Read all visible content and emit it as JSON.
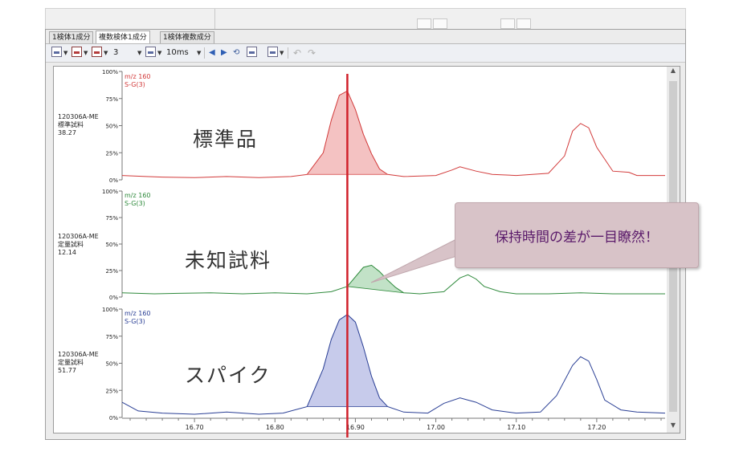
{
  "tabs": [
    {
      "label": "1検体1成分",
      "active": false
    },
    {
      "label": "複数検体1成分",
      "active": true
    },
    {
      "label": "1検体複数成分",
      "active": false
    }
  ],
  "toolbar": {
    "overlay_count": "3",
    "time_step": "10ms"
  },
  "colors": {
    "standard": "#d23a3a",
    "unknown": "#2f8a3c",
    "spike": "#2a3f95",
    "marker": "#d0202a",
    "callout_bg": "#d8c3c8",
    "callout_text": "#5a1a6a"
  },
  "chromatograms": [
    {
      "sample_id": "120306A-ME",
      "sample_type": "標準試料",
      "value": "38.27",
      "mz": "m/z 160",
      "smoothing": "S-G(3)",
      "label": "標準品",
      "y_ticks": [
        "100%",
        "75%",
        "50%",
        "25%",
        "0%"
      ]
    },
    {
      "sample_id": "120306A-ME",
      "sample_type": "定量試料",
      "value": "12.14",
      "mz": "m/z 160",
      "smoothing": "S-G(3)",
      "label": "未知試料",
      "y_ticks": [
        "100%",
        "75%",
        "50%",
        "25%",
        "0%"
      ]
    },
    {
      "sample_id": "120306A-ME",
      "sample_type": "定量試料",
      "value": "51.77",
      "mz": "m/z 160",
      "smoothing": "S-G(3)",
      "label": "スパイク",
      "y_ticks": [
        "100%",
        "75%",
        "50%",
        "25%",
        "0%"
      ]
    }
  ],
  "x_axis": {
    "ticks": [
      "16.70",
      "16.80",
      "16.90",
      "17.00",
      "17.10",
      "17.20"
    ]
  },
  "callout": {
    "text": "保持時間の差が一目瞭然！"
  },
  "chart_data": {
    "type": "line",
    "x_range": [
      16.61,
      17.285
    ],
    "y_range": [
      0,
      100
    ],
    "retention_marker": 16.89,
    "series": [
      {
        "name": "m/z 160",
        "points": [
          [
            16.61,
            4
          ],
          [
            16.64,
            3
          ],
          [
            16.66,
            2.5
          ],
          [
            16.7,
            2
          ],
          [
            16.74,
            3
          ],
          [
            16.78,
            2
          ],
          [
            16.82,
            3
          ],
          [
            16.84,
            5
          ],
          [
            16.86,
            25
          ],
          [
            16.87,
            55
          ],
          [
            16.88,
            78
          ],
          [
            16.89,
            82
          ],
          [
            16.9,
            65
          ],
          [
            16.91,
            42
          ],
          [
            16.92,
            24
          ],
          [
            16.93,
            10
          ],
          [
            16.94,
            5
          ],
          [
            16.96,
            3
          ],
          [
            17.0,
            4
          ],
          [
            17.02,
            9
          ],
          [
            17.03,
            12
          ],
          [
            17.05,
            8
          ],
          [
            17.07,
            5
          ],
          [
            17.1,
            4
          ],
          [
            17.14,
            6
          ],
          [
            17.16,
            22
          ],
          [
            17.17,
            45
          ],
          [
            17.18,
            52
          ],
          [
            17.19,
            48
          ],
          [
            17.2,
            30
          ],
          [
            17.22,
            8
          ],
          [
            17.24,
            7
          ],
          [
            17.25,
            4
          ],
          [
            17.285,
            4
          ]
        ]
      },
      {
        "name": "m/z 160",
        "points": [
          [
            16.61,
            4
          ],
          [
            16.65,
            3
          ],
          [
            16.68,
            3.5
          ],
          [
            16.72,
            4
          ],
          [
            16.76,
            3
          ],
          [
            16.8,
            4
          ],
          [
            16.84,
            3
          ],
          [
            16.87,
            5
          ],
          [
            16.89,
            10
          ],
          [
            16.91,
            28
          ],
          [
            16.92,
            30
          ],
          [
            16.93,
            24
          ],
          [
            16.94,
            16
          ],
          [
            16.95,
            9
          ],
          [
            16.96,
            4
          ],
          [
            16.98,
            3
          ],
          [
            17.01,
            5
          ],
          [
            17.03,
            18
          ],
          [
            17.04,
            21
          ],
          [
            17.05,
            17
          ],
          [
            17.06,
            10
          ],
          [
            17.08,
            5
          ],
          [
            17.1,
            3
          ],
          [
            17.14,
            3
          ],
          [
            17.18,
            4
          ],
          [
            17.22,
            3
          ],
          [
            17.285,
            3
          ]
        ]
      },
      {
        "name": "m/z 160",
        "points": [
          [
            16.61,
            14
          ],
          [
            16.63,
            6
          ],
          [
            16.66,
            4
          ],
          [
            16.7,
            3
          ],
          [
            16.74,
            5
          ],
          [
            16.78,
            3
          ],
          [
            16.81,
            4
          ],
          [
            16.84,
            10
          ],
          [
            16.86,
            45
          ],
          [
            16.87,
            72
          ],
          [
            16.88,
            90
          ],
          [
            16.89,
            95
          ],
          [
            16.9,
            88
          ],
          [
            16.91,
            65
          ],
          [
            16.92,
            38
          ],
          [
            16.93,
            18
          ],
          [
            16.94,
            10
          ],
          [
            16.96,
            5
          ],
          [
            16.99,
            4
          ],
          [
            17.01,
            13
          ],
          [
            17.03,
            18
          ],
          [
            17.05,
            14
          ],
          [
            17.07,
            7
          ],
          [
            17.1,
            4
          ],
          [
            17.13,
            5
          ],
          [
            17.15,
            20
          ],
          [
            17.17,
            48
          ],
          [
            17.18,
            56
          ],
          [
            17.19,
            52
          ],
          [
            17.2,
            35
          ],
          [
            17.21,
            16
          ],
          [
            17.23,
            7
          ],
          [
            17.25,
            5
          ],
          [
            17.285,
            4
          ]
        ]
      }
    ]
  }
}
